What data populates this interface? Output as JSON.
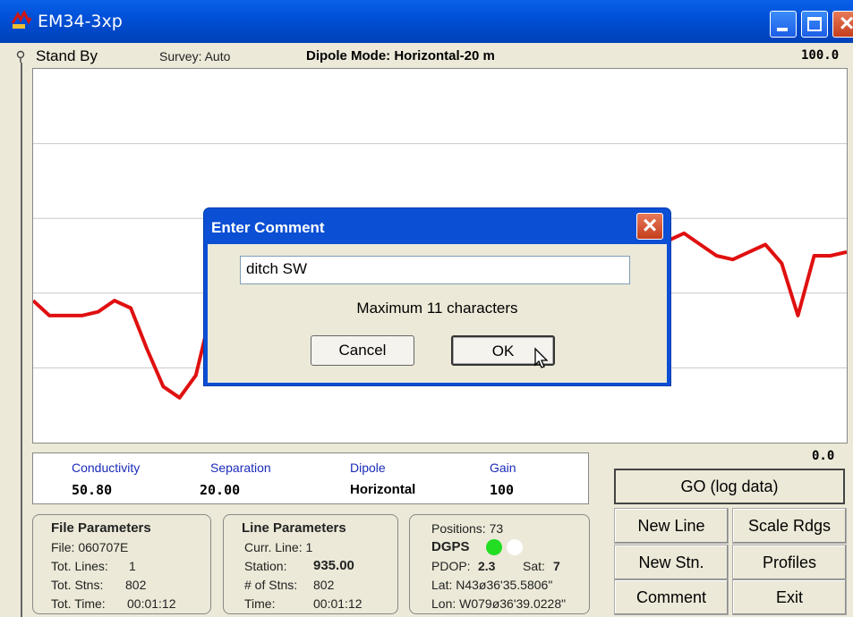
{
  "window": {
    "title": "EM34-3xp"
  },
  "status": {
    "mode": "Stand By",
    "survey": "Survey: Auto",
    "dipole_mode": "Dipole Mode: Horizontal-20 m",
    "scale_max": "100.0",
    "scale_min": "0.0"
  },
  "readings": {
    "conductivity_label": "Conductivity",
    "conductivity_value": "50.80",
    "separation_label": "Separation",
    "separation_value": "20.00",
    "dipole_label": "Dipole",
    "dipole_value": "Horizontal",
    "gain_label": "Gain",
    "gain_value": "100"
  },
  "buttons": {
    "go": "GO (log data)",
    "new_line": "New Line",
    "scale_rdgs": "Scale Rdgs",
    "new_stn": "New Stn.",
    "profiles": "Profiles",
    "comment": "Comment",
    "exit": "Exit"
  },
  "file_params": {
    "title": "File Parameters",
    "file": "File: 060707E",
    "tot_lines_label": "Tot. Lines:",
    "tot_lines": "1",
    "tot_stns_label": "Tot. Stns:",
    "tot_stns": "802",
    "tot_time_label": "Tot. Time:",
    "tot_time": "00:01:12"
  },
  "line_params": {
    "title": "Line Parameters",
    "curr_line": "Curr. Line: 1",
    "station_label": "Station:",
    "station": "935.00",
    "num_stns_label": "# of Stns:",
    "num_stns": "802",
    "time_label": "Time:",
    "time": "00:01:12"
  },
  "gps": {
    "positions": "Positions: 73",
    "mode": "DGPS",
    "pdop_label": "PDOP:",
    "pdop": "2.3",
    "sat_label": "Sat:",
    "sat": "7",
    "lat": "Lat: N43ø36'35.5806\"",
    "lon": "Lon: W079ø36'39.0228\"",
    "status_colors": [
      "#22dd22",
      "#ffffff"
    ]
  },
  "dialog": {
    "title": "Enter Comment",
    "input_value": "ditch SW",
    "message": "Maximum 11 characters",
    "cancel": "Cancel",
    "ok": "OK"
  },
  "chart_data": {
    "type": "line",
    "title": "",
    "xlabel": "",
    "ylabel": "",
    "ylim": [
      0,
      100
    ],
    "grid": true,
    "series": [
      {
        "color": "#e01010",
        "x": [
          0,
          2,
          4,
          6,
          8,
          10,
          12,
          14,
          16,
          18,
          20,
          22,
          24,
          26,
          28,
          30,
          32,
          34,
          36,
          38,
          40,
          42,
          44,
          46,
          48,
          50,
          52,
          54,
          56,
          58,
          60,
          62,
          64,
          66,
          68,
          70,
          72,
          74,
          76,
          78,
          80,
          82,
          84,
          86,
          88,
          90,
          92,
          94,
          96,
          98,
          100
        ],
        "y": [
          38,
          34,
          34,
          34,
          35,
          38,
          36,
          25,
          15,
          12,
          18,
          36,
          57,
          42,
          35,
          37,
          38,
          46,
          44,
          42,
          40,
          38,
          41,
          44,
          47,
          46,
          44,
          48,
          50,
          51,
          48,
          52,
          54,
          54,
          53,
          53,
          56,
          55,
          54,
          54,
          56,
          53,
          50,
          49,
          51,
          53,
          48,
          34,
          50,
          50,
          51
        ]
      }
    ]
  }
}
